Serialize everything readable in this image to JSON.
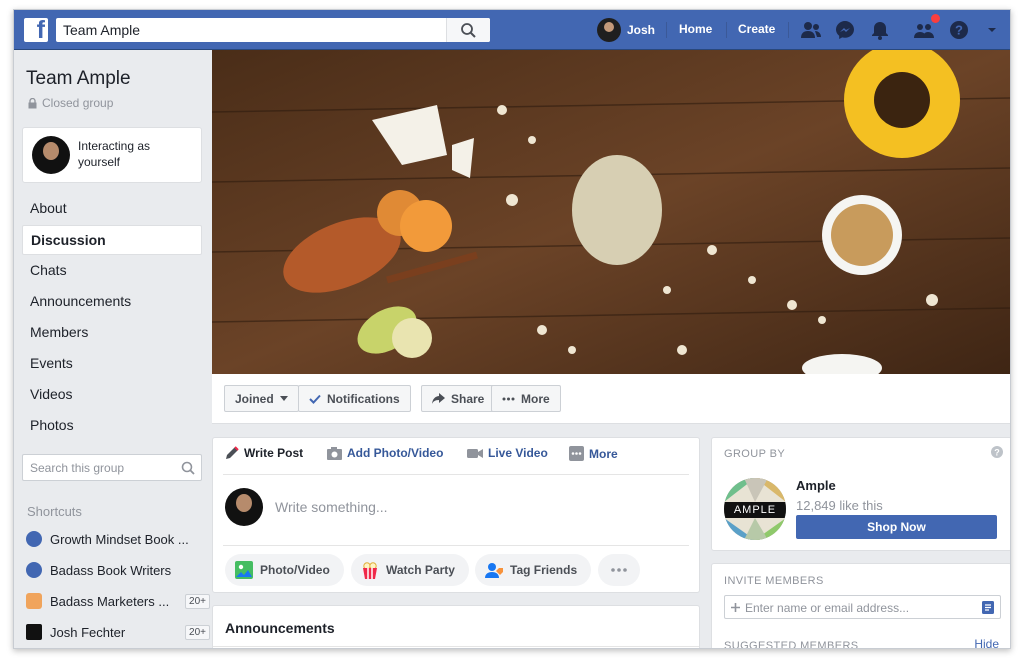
{
  "topbar": {
    "search_value": "Team Ample",
    "user_name": "Josh",
    "home_label": "Home",
    "create_label": "Create",
    "brand_color": "#4267b2"
  },
  "sidebar": {
    "group_name": "Team Ample",
    "group_privacy": "Closed group",
    "acting_as": "Interacting as yourself",
    "nav": [
      "About",
      "Discussion",
      "Chats",
      "Announcements",
      "Members",
      "Events",
      "Videos",
      "Photos"
    ],
    "active_nav": "Discussion",
    "search_placeholder": "Search this group",
    "shortcuts_heading": "Shortcuts",
    "shortcuts": [
      {
        "label": "Growth Mindset Book ...",
        "count": ""
      },
      {
        "label": "Badass Book Writers",
        "count": ""
      },
      {
        "label": "Badass Marketers ...",
        "count": "20+"
      },
      {
        "label": "Josh Fechter",
        "count": "20+"
      }
    ]
  },
  "cover_actions": {
    "joined": "Joined",
    "notifications": "Notifications",
    "share": "Share",
    "more": "More"
  },
  "composer": {
    "tabs": [
      "Write Post",
      "Add Photo/Video",
      "Live Video",
      "More"
    ],
    "placeholder": "Write something...",
    "actions": [
      "Photo/Video",
      "Watch Party",
      "Tag Friends"
    ]
  },
  "announcements": {
    "title": "Announcements"
  },
  "group_by": {
    "heading": "GROUP BY",
    "page_name": "Ample",
    "logo_text": "AMPLE",
    "likes": "12,849 like this",
    "cta": "Shop Now"
  },
  "invite": {
    "heading": "INVITE MEMBERS",
    "placeholder": "Enter name or email address...",
    "suggested_heading": "SUGGESTED MEMBERS",
    "hide": "Hide"
  }
}
